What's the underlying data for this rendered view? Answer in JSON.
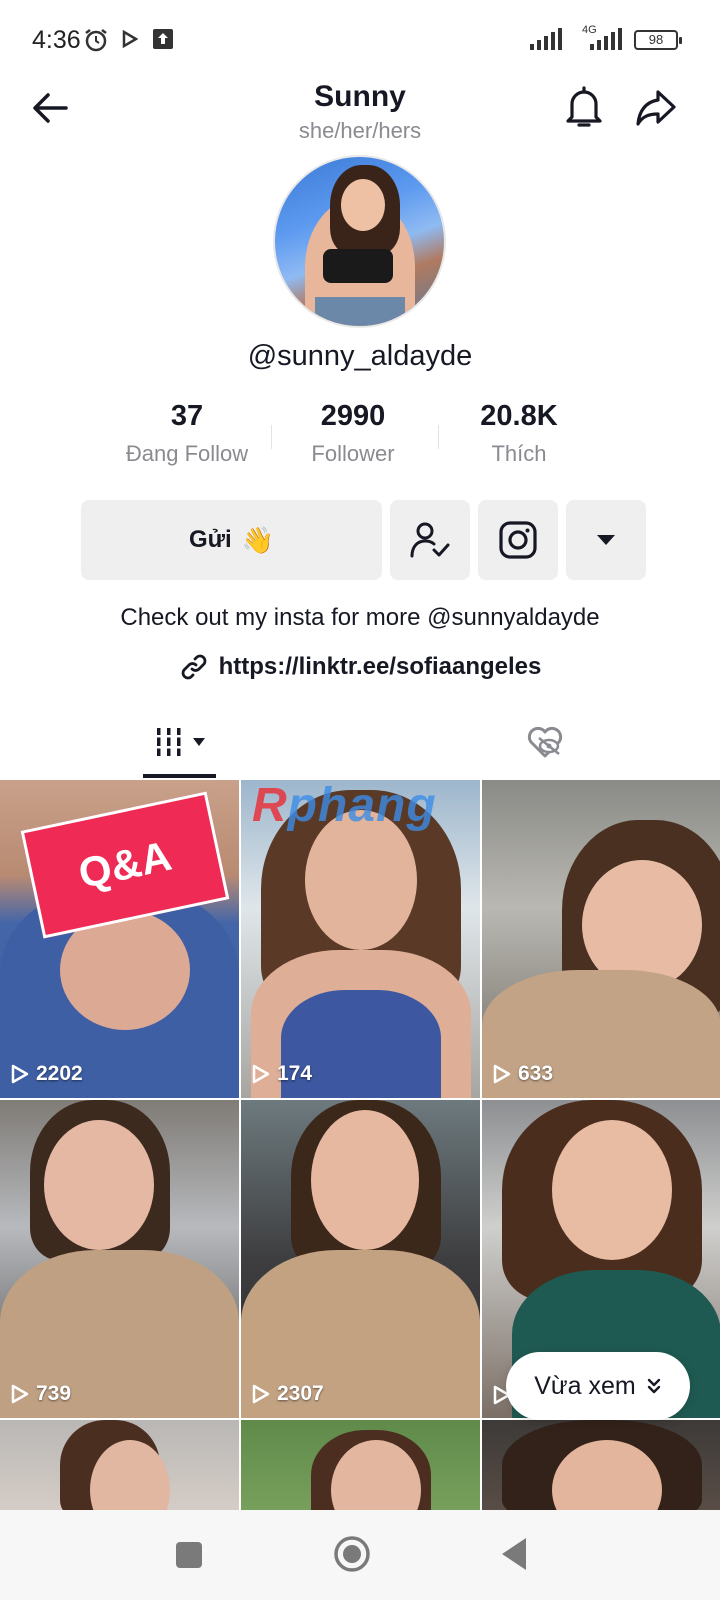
{
  "status_bar": {
    "time": "4:36",
    "network": "4G",
    "battery": "98",
    "icons": [
      "alarm-icon",
      "play-icon",
      "upload-icon",
      "signal-icon",
      "battery-icon"
    ]
  },
  "header": {
    "name": "Sunny",
    "pronouns": "she/her/hers",
    "icons": [
      "back-arrow-icon",
      "bell-icon",
      "share-icon"
    ]
  },
  "profile": {
    "username": "@sunny_aldayde",
    "stats": [
      {
        "value": "37",
        "label": "Đang Follow"
      },
      {
        "value": "2990",
        "label": "Follower"
      },
      {
        "value": "20.8K",
        "label": "Thích"
      }
    ],
    "actions": {
      "send_label": "Gửi",
      "send_emoji": "👋",
      "icons": [
        "following-check-icon",
        "instagram-icon",
        "dropdown-triangle-icon"
      ]
    },
    "bio": "Check out my insta for more @sunnyaldayde",
    "link": "https://linktr.ee/sofiaangeles"
  },
  "tabs": {
    "items": [
      "videos-grid-icon",
      "liked-hidden-icon"
    ],
    "active": 0
  },
  "watermark": {
    "first": "R",
    "rest": "phang"
  },
  "videos": [
    {
      "views": "2202",
      "sticker": "Q&A"
    },
    {
      "views": "174"
    },
    {
      "views": "633"
    },
    {
      "views": "739"
    },
    {
      "views": "2307"
    },
    {
      "views": ""
    },
    {
      "views": ""
    },
    {
      "views": ""
    },
    {
      "views": ""
    }
  ],
  "recent_pill": {
    "label": "Vừa xem"
  },
  "nav_bar": {
    "icons": [
      "recent-apps-icon",
      "home-icon",
      "back-icon"
    ]
  },
  "colors": {
    "accent": "#ee2a55",
    "text": "#161823",
    "muted": "#8a8b91",
    "button_bg": "#efefef"
  }
}
